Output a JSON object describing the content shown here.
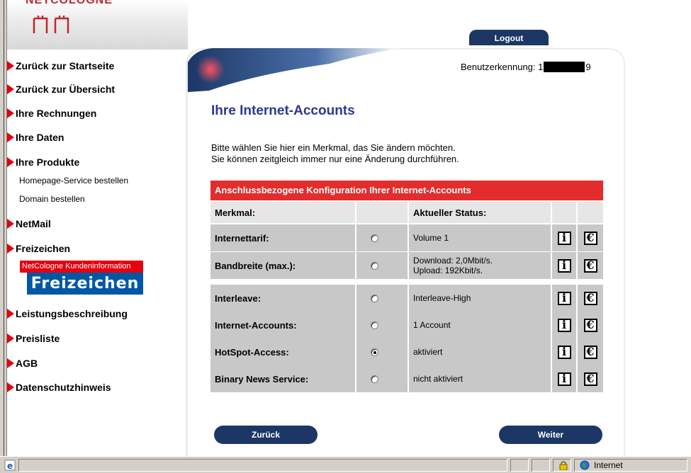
{
  "header": {
    "logo_text": "NETCOLOGNE",
    "logout_label": "Logout",
    "user_label": "Benutzerkennung: 1",
    "user_suffix": "9"
  },
  "nav": {
    "items": [
      {
        "label": "Zurück zur Startseite"
      },
      {
        "label": "Zurück zur Übersicht"
      },
      {
        "label": "Ihre Rechnungen"
      },
      {
        "label": "Ihre Daten"
      },
      {
        "label": "Ihre Produkte"
      },
      {
        "label": "NetMail"
      },
      {
        "label": "Freizeichen"
      },
      {
        "label": "Leistungsbeschreibung"
      },
      {
        "label": "Preisliste"
      },
      {
        "label": "AGB"
      },
      {
        "label": "Datenschutzhinweis"
      }
    ],
    "sub_items": [
      {
        "label": "Homepage-Service bestellen"
      },
      {
        "label": "Domain bestellen"
      }
    ],
    "banner": {
      "top": "NetCologne Kundeninformation",
      "bottom": "Freizeichen"
    }
  },
  "main": {
    "title": "Ihre Internet-Accounts",
    "intro_line1": "Bitte wählen Sie hier ein Merkmal, das Sie ändern möchten.",
    "intro_line2": "Sie können zeitgleich immer nur eine Änderung durchführen.",
    "table": {
      "caption": "Anschlussbezogene Konfiguration Ihrer Internet-Accounts",
      "col_feature": "Merkmal:",
      "col_status": "Aktueller Status:",
      "info_glyph": "i",
      "euro_glyph": "€",
      "rows": [
        {
          "feature": "Internettarif:",
          "status1": "Volume 1",
          "status2": "",
          "selected": false
        },
        {
          "feature": "Bandbreite (max.):",
          "status1": "Download: 2,0Mbit/s.",
          "status2": "Upload: 192Kbit/s.",
          "selected": false
        },
        {
          "feature": "Interleave:",
          "status1": "Interleave-High",
          "status2": "",
          "selected": false
        },
        {
          "feature": "Internet-Accounts:",
          "status1": "1 Account",
          "status2": "",
          "selected": false
        },
        {
          "feature": "HotSpot-Access:",
          "status1": "aktiviert",
          "status2": "",
          "selected": true
        },
        {
          "feature": "Binary News Service:",
          "status1": "nicht aktiviert",
          "status2": "",
          "selected": false
        }
      ]
    },
    "back_label": "Zurück",
    "next_label": "Weiter"
  },
  "statusbar": {
    "zone_label": "Internet"
  },
  "colors": {
    "accent_red": "#e3000f",
    "header_red": "#e32c2c",
    "navy": "#1c3766",
    "title_blue": "#2b3a8e"
  }
}
